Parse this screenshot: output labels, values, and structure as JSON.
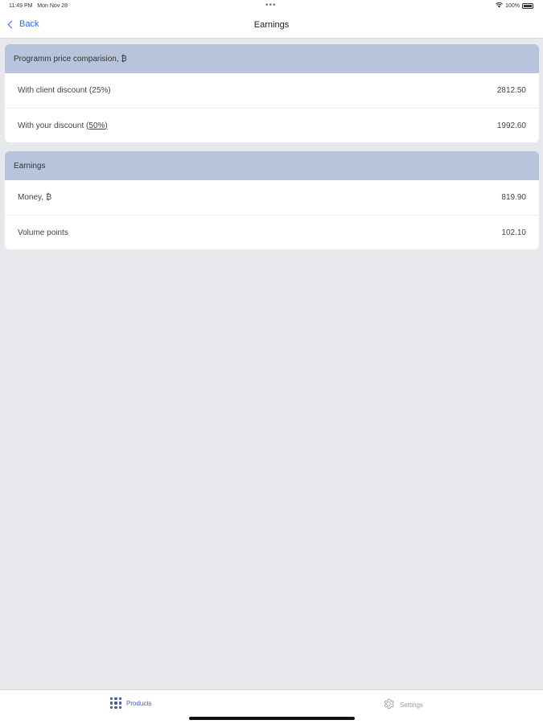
{
  "status_bar": {
    "time": "11:49 PM",
    "date": "Mon Nov 28",
    "dots": "•••",
    "battery": "100%"
  },
  "nav": {
    "back_label": "Back",
    "title": "Earnings"
  },
  "price_comparison": {
    "header": "Programm price comparision, ₿",
    "rows": [
      {
        "label": "With client discount (25%)",
        "value": "2812.50"
      },
      {
        "label_prefix": "With your discount ",
        "label_link": "(50%)",
        "value": "1992.60"
      }
    ]
  },
  "earnings": {
    "header": "Earnings",
    "rows": [
      {
        "label": "Money, ₿",
        "value": "819.90"
      },
      {
        "label": "Volume points",
        "value": "102.10"
      }
    ]
  },
  "tabs": [
    {
      "label": "Products",
      "icon": "grid-icon",
      "active": true,
      "color": "#4a5fa8"
    },
    {
      "label": "Settings",
      "icon": "gear-icon",
      "active": false,
      "color": "#9a9a9a"
    }
  ],
  "colors": {
    "accent": "#2f6fd6",
    "header_bg": "#b8c3dc",
    "page_bg": "#e6e8ec"
  }
}
